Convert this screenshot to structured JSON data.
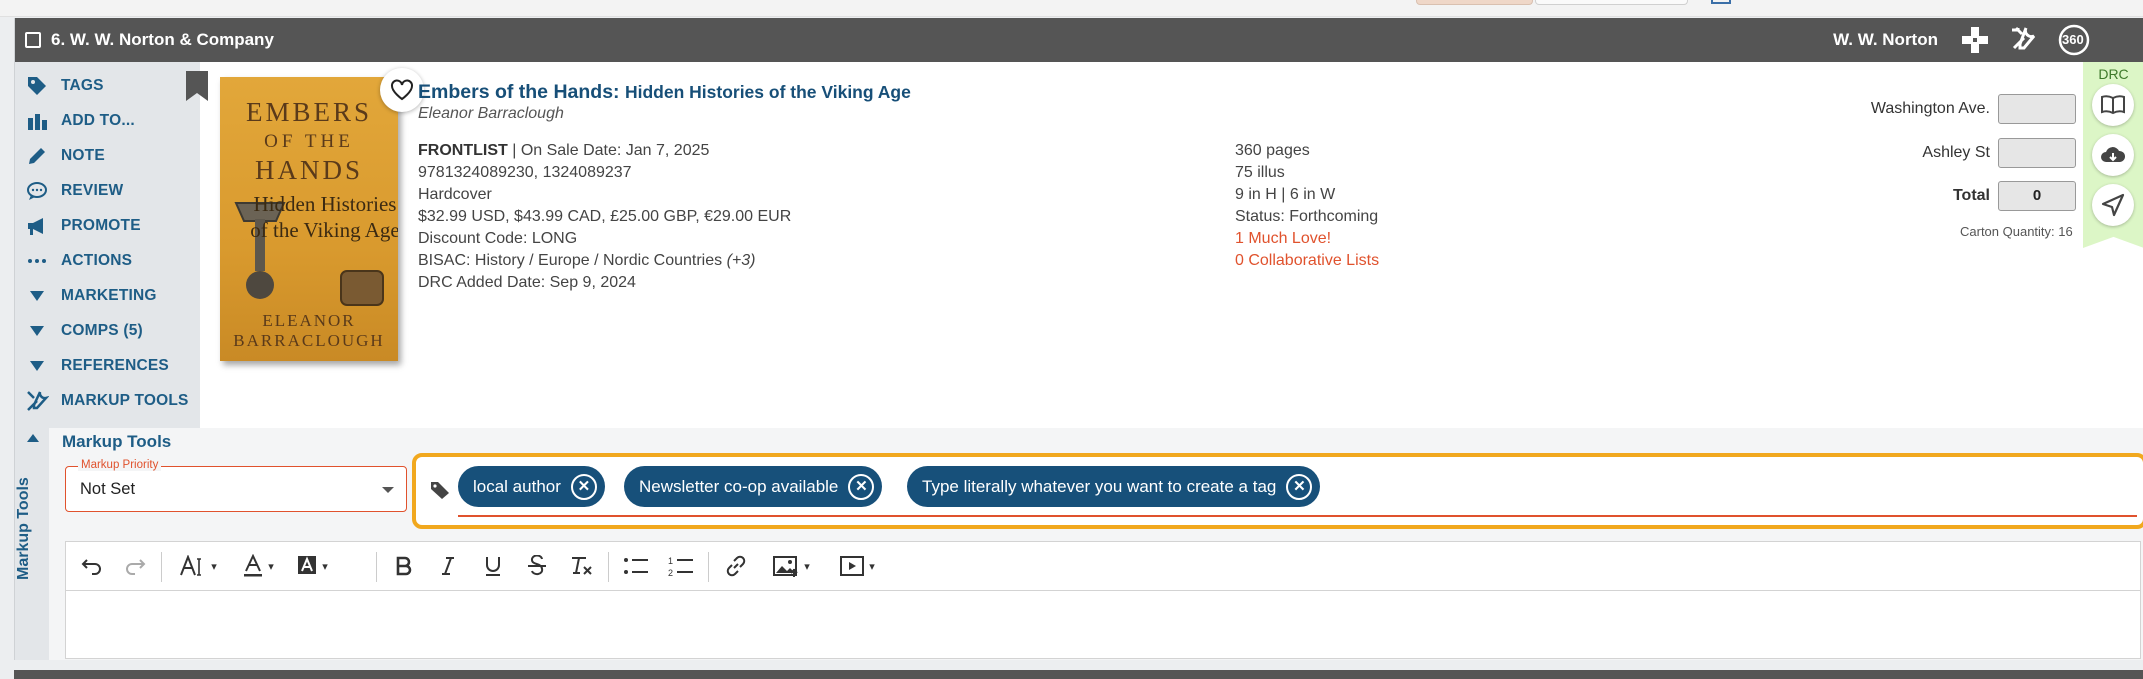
{
  "header": {
    "title": "6. W. W. Norton & Company",
    "publisher": "W. W. Norton",
    "icons": [
      "medical-cross-icon",
      "tools-icon",
      "360-icon"
    ],
    "badge_360": "360"
  },
  "sidebar": {
    "items": [
      {
        "label": "TAGS",
        "icon": "tag-icon"
      },
      {
        "label": "ADD TO...",
        "icon": "add-to-icon"
      },
      {
        "label": "NOTE",
        "icon": "pencil-icon"
      },
      {
        "label": "REVIEW",
        "icon": "speech-bubble-icon"
      },
      {
        "label": "PROMOTE",
        "icon": "megaphone-icon"
      },
      {
        "label": "ACTIONS",
        "icon": "ellipsis-icon"
      },
      {
        "label": "MARKETING",
        "icon": "triangle-down-icon"
      },
      {
        "label": "COMPS (5)",
        "icon": "triangle-down-icon"
      },
      {
        "label": "REFERENCES",
        "icon": "triangle-down-icon"
      },
      {
        "label": "MARKUP TOOLS",
        "icon": "tools-icon"
      }
    ]
  },
  "cover": {
    "line1": "EMBERS",
    "line2": "OF THE",
    "line3": "HANDS",
    "line4": "Hidden Histories of the Viking Age",
    "line5": "ELEANOR BARRACLOUGH"
  },
  "book": {
    "title_main": "Embers of the Hands:",
    "title_sub": "Hidden Histories of the Viking Age",
    "author": "Eleanor Barraclough",
    "frontlist": "FRONTLIST",
    "on_sale": "On Sale Date: Jan 7, 2025",
    "isbns": "9781324089230, 1324089237",
    "format": "Hardcover",
    "prices": "$32.99 USD, $43.99 CAD, £25.00 GBP, €29.00 EUR",
    "discount": "Discount Code: LONG",
    "bisac": "BISAC: History / Europe / Nordic Countries",
    "bisac_more": "(+3)",
    "drc_added": "DRC Added Date: Sep 9, 2024",
    "pages": "360 pages",
    "illus": "75 illus",
    "dimensions": "9 in H | 6 in W",
    "status": "Status: Forthcoming",
    "love": "1 Much Love!",
    "lists": "0 Collaborative Lists"
  },
  "locations": {
    "loc1_label": "Washington Ave.",
    "loc1_value": "",
    "loc2_label": "Ashley St",
    "loc2_value": "",
    "total_label": "Total",
    "total_value": "0",
    "carton": "Carton Quantity: 16"
  },
  "drc": {
    "label": "DRC",
    "buttons": [
      "open-book-icon",
      "cloud-download-icon",
      "paper-plane-icon"
    ]
  },
  "markup": {
    "side_label": "Markup Tools",
    "title": "Markup Tools",
    "priority_legend": "Markup Priority",
    "priority_value": "Not Set",
    "tags": [
      "local author",
      "Newsletter co-op available",
      "Type literally whatever you want to create a tag"
    ]
  },
  "colors": {
    "header_bg": "#555555",
    "accent_blue": "#17507a",
    "accent_orange": "#e0522d",
    "highlight": "#f1a81e",
    "drc_green": "#dcf6c6"
  }
}
